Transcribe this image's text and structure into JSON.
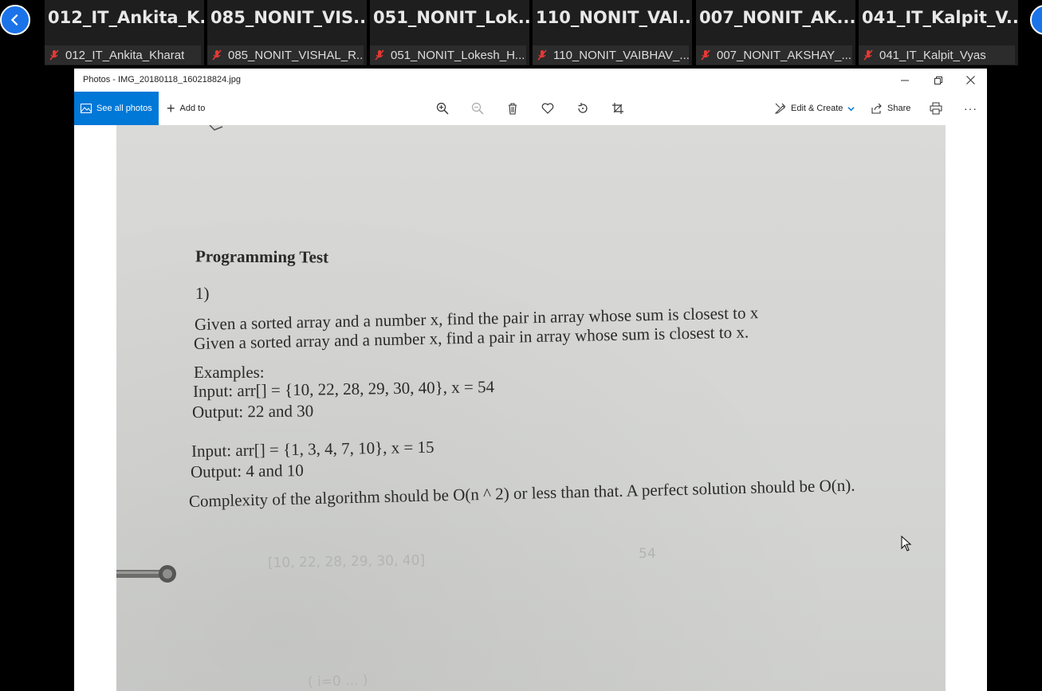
{
  "meeting": {
    "participants": [
      {
        "tile_name": "012_IT_Ankita_K...",
        "label": "012_IT_Ankita_Kharat"
      },
      {
        "tile_name": "085_NONIT_VIS...",
        "label": "085_NONIT_VISHAL_R..."
      },
      {
        "tile_name": "051_NONIT_Lok...",
        "label": "051_NONIT_Lokesh_H..."
      },
      {
        "tile_name": "110_NONIT_VAI...",
        "label": "110_NONIT_VAIBHAV_..."
      },
      {
        "tile_name": "007_NONIT_AK...",
        "label": "007_NONIT_AKSHAY_..."
      },
      {
        "tile_name": "041_IT_Kalpit_V...",
        "label": "041_IT_Kalpit_Vyas"
      }
    ],
    "mic_icon": "mic-muted-icon",
    "accent_color": "#1a73e8",
    "muted_color": "#e53935"
  },
  "photos": {
    "title": "Photos - IMG_20180118_160218824.jpg",
    "see_all_label": "See all photos",
    "add_to_label": "Add to",
    "edit_create_label": "Edit & Create",
    "share_label": "Share",
    "more_label": "···",
    "accent_color": "#0078d7"
  },
  "document": {
    "heading": "Programming Test",
    "question_number": "1)",
    "line1": "Given a sorted array and a number x, find the pair in array whose sum is closest to x",
    "line2": "Given a sorted array and a number x, find a pair in array whose sum is closest to x.",
    "examples_label": "Examples:",
    "input1": "Input: arr[] = {10, 22, 28, 29, 30, 40}, x = 54",
    "output1": "Output: 22 and 30",
    "input2": "Input: arr[] = {1, 3, 4, 7, 10}, x = 15",
    "output2": "Output: 4 and 10",
    "complexity": "Complexity of the algorithm should be O(n ^ 2) or less than that. A perfect solution should be O(n).",
    "handwritten1": "[10, 22, 28, 29, 30, 40]",
    "handwritten1b": "54",
    "handwritten2": "( i=0 ... )"
  }
}
